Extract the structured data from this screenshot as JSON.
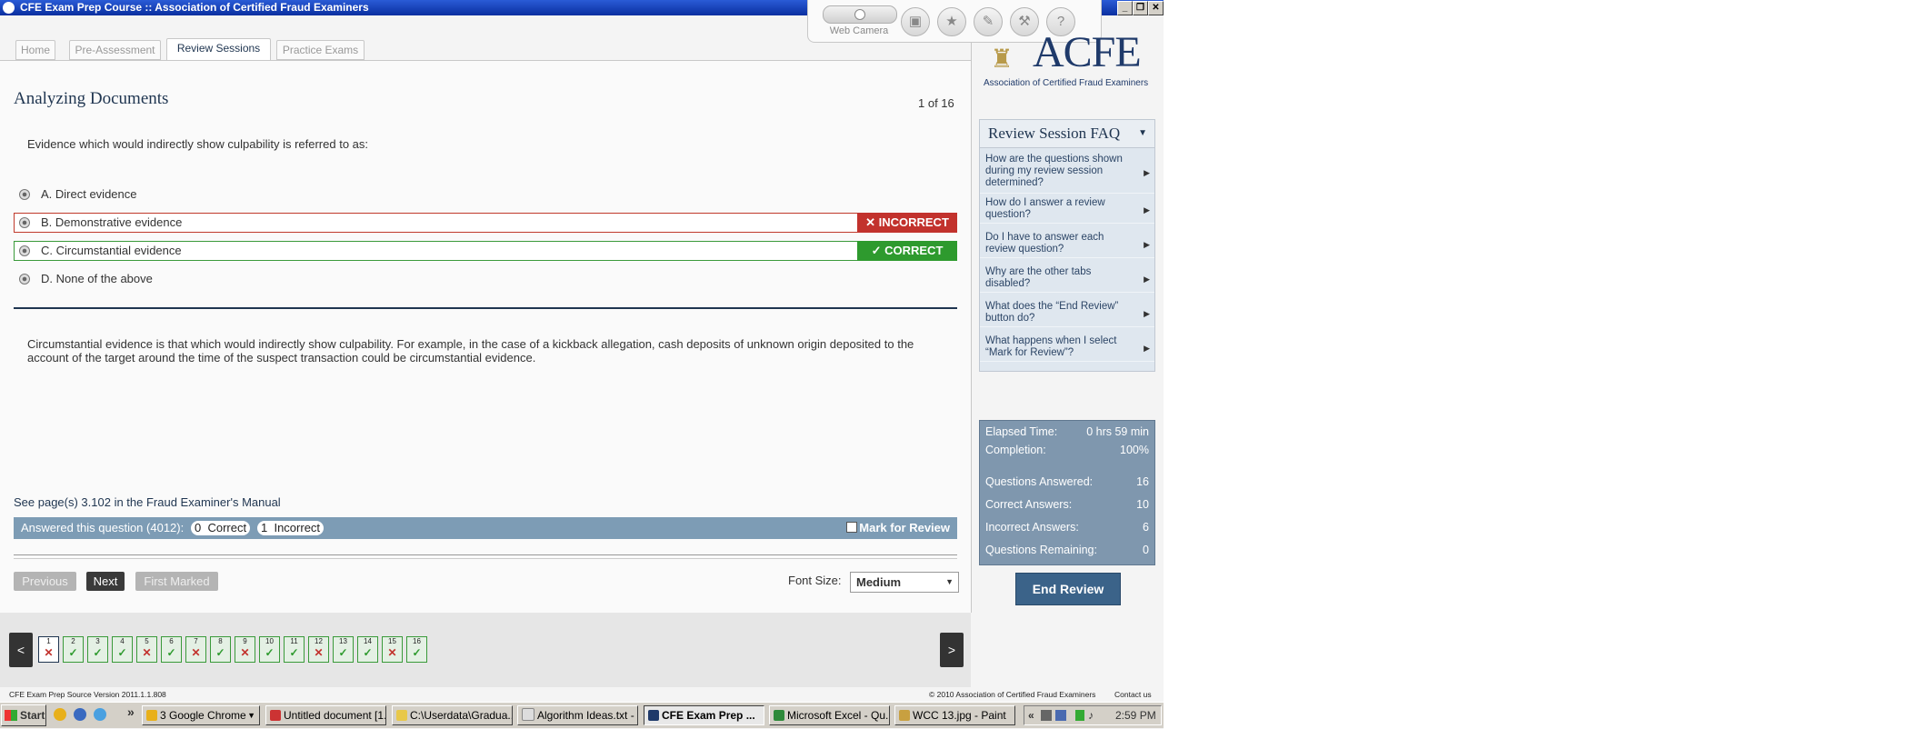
{
  "window": {
    "title": "CFE Exam Prep Course :: Association of Certified Fraud Examiners"
  },
  "toolbox": {
    "camera_label": "Web Camera",
    "help_glyph": "?"
  },
  "tabs": [
    {
      "label": "Home"
    },
    {
      "label": "Pre-Assessment"
    },
    {
      "label": "Review Sessions"
    },
    {
      "label": "Practice Exams"
    }
  ],
  "question": {
    "section_title": "Analyzing Documents",
    "counter": "1 of 16",
    "text": "Evidence which would indirectly show culpability is referred to as:",
    "options": [
      {
        "label": "A.  Direct evidence"
      },
      {
        "label": "B.  Demonstrative evidence",
        "badge": "✕ INCORRECT"
      },
      {
        "label": "C.  Circumstantial evidence",
        "badge": "✓  CORRECT"
      },
      {
        "label": "D.  None of the above"
      }
    ],
    "explanation": "Circumstantial evidence is that which would indirectly show culpability. For example, in the case of a kickback allegation, cash deposits of unknown origin deposited to the account of the target around the time of the suspect transaction could be circumstantial evidence.",
    "reference": "See page(s) 3.102 in the Fraud Examiner's Manual",
    "answered_label": "Answered this question (4012):",
    "correct_count": "0",
    "correct_word": "Correct",
    "incorrect_count": "1",
    "incorrect_word": "Incorrect",
    "mark_for_review": "Mark for Review"
  },
  "controls": {
    "previous": "Previous",
    "next": "Next",
    "first_marked": "First Marked",
    "font_size_label": "Font Size:",
    "font_size_value": "Medium"
  },
  "logo": {
    "name": "ACFE",
    "tagline": "Association of Certified Fraud Examiners"
  },
  "faq": {
    "title": "Review Session FAQ",
    "items": [
      "How are the questions shown during my review session determined?",
      "How do I answer a review question?",
      "Do I have to answer each review question?",
      "Why are the other tabs disabled?",
      "What does the “End Review” button do?",
      "What happens when I select “Mark for Review”?"
    ]
  },
  "stats": {
    "elapsed_label": "Elapsed Time:",
    "elapsed_value": "0 hrs 59 min",
    "completion_label": "Completion:",
    "completion_value": "100%",
    "answered_label": "Questions Answered:",
    "answered_value": "16",
    "correct_label": "Correct Answers:",
    "correct_value": "10",
    "incorrect_label": "Incorrect Answers:",
    "incorrect_value": "6",
    "remaining_label": "Questions Remaining:",
    "remaining_value": "0"
  },
  "end_review": "End Review",
  "nav": {
    "prev": "<",
    "next": ">",
    "questions": [
      {
        "n": "1",
        "result": "incorrect",
        "mark": "✕"
      },
      {
        "n": "2",
        "result": "correct",
        "mark": "✓"
      },
      {
        "n": "3",
        "result": "correct",
        "mark": "✓"
      },
      {
        "n": "4",
        "result": "correct",
        "mark": "✓"
      },
      {
        "n": "5",
        "result": "incorrect",
        "mark": "✕"
      },
      {
        "n": "6",
        "result": "correct",
        "mark": "✓"
      },
      {
        "n": "7",
        "result": "incorrect",
        "mark": "✕"
      },
      {
        "n": "8",
        "result": "correct",
        "mark": "✓"
      },
      {
        "n": "9",
        "result": "incorrect",
        "mark": "✕"
      },
      {
        "n": "10",
        "result": "correct",
        "mark": "✓"
      },
      {
        "n": "11",
        "result": "correct",
        "mark": "✓"
      },
      {
        "n": "12",
        "result": "incorrect",
        "mark": "✕"
      },
      {
        "n": "13",
        "result": "correct",
        "mark": "✓"
      },
      {
        "n": "14",
        "result": "correct",
        "mark": "✓"
      },
      {
        "n": "15",
        "result": "incorrect",
        "mark": "✕"
      },
      {
        "n": "16",
        "result": "correct",
        "mark": "✓"
      }
    ]
  },
  "footer": {
    "version": "CFE Exam Prep Source Version 2011.1.1.808",
    "copyright": "© 2010 Association of Certified Fraud Examiners",
    "contact": "Contact us"
  },
  "taskbar": {
    "start": "Start",
    "chevron": "»",
    "tasks": [
      "3 Google Chrome",
      "Untitled document [1...",
      "C:\\Userdata\\Gradua...",
      "Algorithm Ideas.txt - ...",
      "CFE Exam Prep ...",
      "Microsoft Excel - Qu...",
      "WCC 13.jpg - Paint"
    ],
    "tray_chevron": "«",
    "clock": "2:59 PM"
  },
  "colors": {
    "navy": "#1f3550",
    "incorrect": "#c2322d",
    "correct": "#2e9a2e",
    "stats_bg": "#7f97ae",
    "end_button": "#3b6389"
  }
}
